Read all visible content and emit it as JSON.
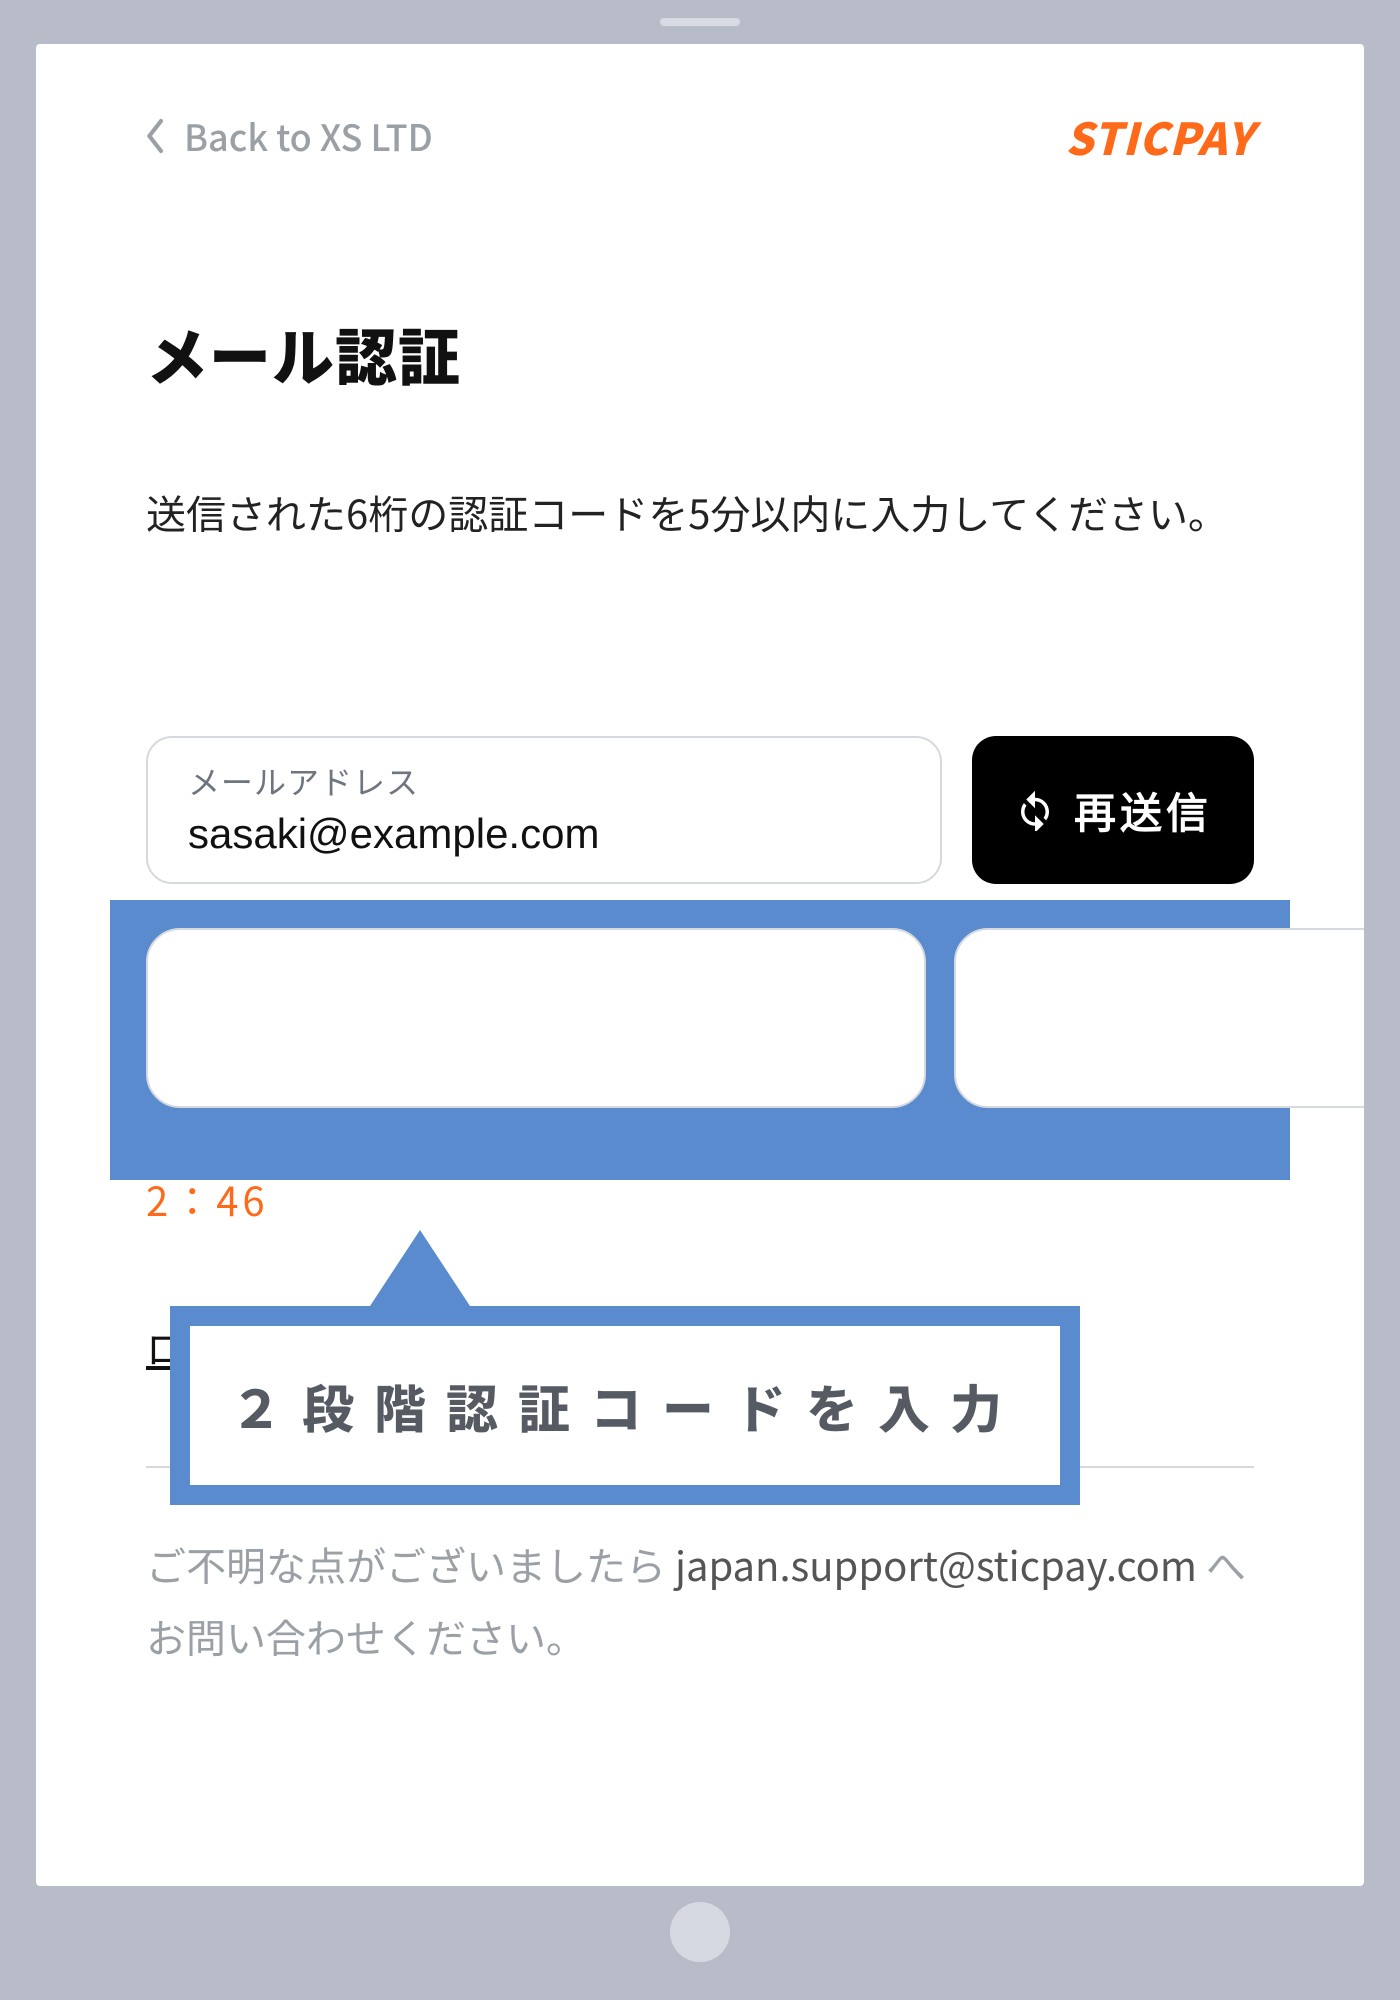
{
  "header": {
    "back_label": "Back to XS LTD",
    "brand": "STICPAY"
  },
  "title": "メール認証",
  "subtitle": "送信された6桁の認証コードを5分以内に入力してください。",
  "email_field": {
    "label": "メールアドレス",
    "value": "sasaki@example.com"
  },
  "resend_label": "再送信",
  "otp": {
    "digits": 6,
    "values": [
      "",
      "",
      "",
      "",
      "",
      ""
    ]
  },
  "timer": "2：46",
  "login_link": "ロ",
  "help": {
    "pre": "ご不明な点がございましたら ",
    "email": "japan.support@sticpay.com",
    "post": " へお問い合わせください。"
  },
  "callout": "２段階認証コードを入力",
  "colors": {
    "accent": "#ff6a1a",
    "highlight": "#5a8bcf"
  }
}
